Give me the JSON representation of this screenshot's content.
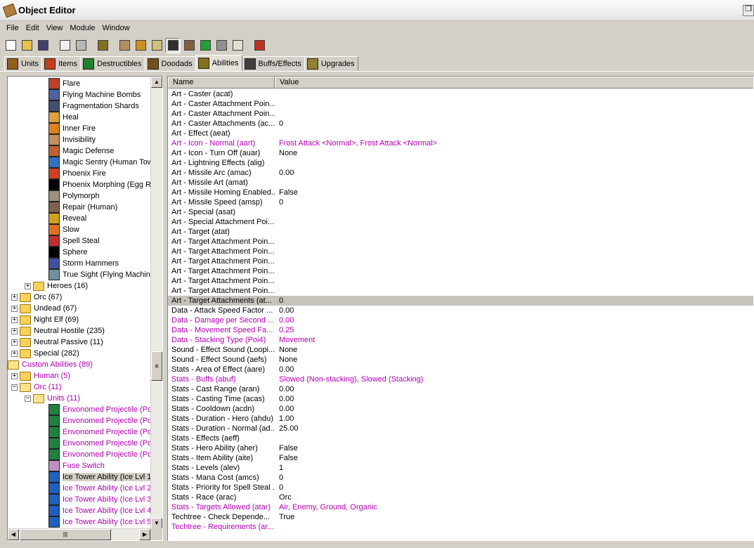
{
  "window": {
    "title": "Object Editor",
    "restore_glyph": "❐"
  },
  "menu": [
    "File",
    "Edit",
    "View",
    "Module",
    "Window"
  ],
  "toolbar": {
    "buttons": [
      {
        "icon": "new-icon",
        "color": "#ffffff"
      },
      {
        "icon": "open-icon",
        "color": "#e8c050"
      },
      {
        "icon": "save-icon",
        "color": "#404070"
      },
      {
        "sep": true
      },
      {
        "icon": "copy-icon",
        "color": "#f0f0f0"
      },
      {
        "icon": "paste-icon",
        "color": "#b8b8b8"
      },
      {
        "sep": true
      },
      {
        "icon": "abilities-icon",
        "color": "#807020"
      },
      {
        "sep": true
      },
      {
        "icon": "terrain-icon",
        "color": "#b09060"
      },
      {
        "icon": "doodad-icon",
        "color": "#d09020"
      },
      {
        "icon": "sound-icon",
        "color": "#d0c080"
      },
      {
        "icon": "object-icon",
        "color": "#303030",
        "pressed": true
      },
      {
        "icon": "camera-icon",
        "color": "#806040"
      },
      {
        "icon": "region-icon",
        "color": "#20a030"
      },
      {
        "icon": "unit-icon",
        "color": "#909090"
      },
      {
        "icon": "import-icon",
        "color": "#e0e0d0"
      },
      {
        "sep": true
      },
      {
        "icon": "test-map-icon",
        "color": "#c03020"
      }
    ]
  },
  "tabs": [
    {
      "label": "Units",
      "icon": "units-tab-icon",
      "color": "#906020",
      "active": false
    },
    {
      "label": "Items",
      "icon": "items-tab-icon",
      "color": "#c04020",
      "active": false
    },
    {
      "label": "Destructibles",
      "icon": "destructibles-tab-icon",
      "color": "#208030",
      "active": false
    },
    {
      "label": "Doodads",
      "icon": "doodads-tab-icon",
      "color": "#705020",
      "active": false
    },
    {
      "label": "Abilities",
      "icon": "abilities-tab-icon",
      "color": "#807020",
      "active": true
    },
    {
      "label": "Buffs/Effects",
      "icon": "buffs-tab-icon",
      "color": "#404040",
      "active": false
    },
    {
      "label": "Upgrades",
      "icon": "upgrades-tab-icon",
      "color": "#908030",
      "active": false
    }
  ],
  "tree": [
    {
      "label": "Flare",
      "type": "ability",
      "indent": 58,
      "color": "#c04030"
    },
    {
      "label": "Flying Machine Bombs",
      "type": "ability",
      "indent": 58,
      "color": "#5060a0"
    },
    {
      "label": "Fragmentation Shards",
      "type": "ability",
      "indent": 58,
      "color": "#405070"
    },
    {
      "label": "Heal",
      "type": "ability",
      "indent": 58,
      "color": "#e0a040"
    },
    {
      "label": "Inner Fire",
      "type": "ability",
      "indent": 58,
      "color": "#e08020"
    },
    {
      "label": "Invisibility",
      "type": "ability",
      "indent": 58,
      "color": "#c09060"
    },
    {
      "label": "Magic Defense",
      "type": "ability",
      "indent": 58,
      "color": "#c06030"
    },
    {
      "label": "Magic Sentry (Human Tow",
      "type": "ability",
      "indent": 58,
      "color": "#3070c0"
    },
    {
      "label": "Phoenix Fire",
      "type": "ability",
      "indent": 58,
      "color": "#d04020"
    },
    {
      "label": "Phoenix Morphing (Egg Re",
      "type": "ability",
      "indent": 58,
      "color": "#000000"
    },
    {
      "label": "Polymorph",
      "type": "ability",
      "indent": 58,
      "color": "#a09080"
    },
    {
      "label": "Repair (Human)",
      "type": "ability",
      "indent": 58,
      "color": "#806050"
    },
    {
      "label": "Reveal",
      "type": "ability",
      "indent": 58,
      "color": "#d0a020"
    },
    {
      "label": "Slow",
      "type": "ability",
      "indent": 58,
      "color": "#e07020"
    },
    {
      "label": "Spell Steal",
      "type": "ability",
      "indent": 58,
      "color": "#c03030"
    },
    {
      "label": "Sphere",
      "type": "ability",
      "indent": 58,
      "color": "#000000"
    },
    {
      "label": "Storm Hammers",
      "type": "ability",
      "indent": 58,
      "color": "#4050a0"
    },
    {
      "label": "True Sight (Flying Machine",
      "type": "ability",
      "indent": 58,
      "color": "#7090a0"
    },
    {
      "label": "Heroes (16)",
      "type": "folder",
      "indent": 24,
      "exp": "+"
    },
    {
      "label": "Orc (67)",
      "type": "folder",
      "indent": 5,
      "exp": "+"
    },
    {
      "label": "Undead (67)",
      "type": "folder",
      "indent": 5,
      "exp": "+"
    },
    {
      "label": "Night Elf (69)",
      "type": "folder",
      "indent": 5,
      "exp": "+"
    },
    {
      "label": "Neutral Hostile (235)",
      "type": "folder",
      "indent": 5,
      "exp": "+"
    },
    {
      "label": "Neutral Passive (11)",
      "type": "folder",
      "indent": 5,
      "exp": "+"
    },
    {
      "label": "Special (282)",
      "type": "folder",
      "indent": 5,
      "exp": "+"
    },
    {
      "label": "Custom Abilities (89)",
      "type": "folder-open",
      "indent": 0,
      "purple": true
    },
    {
      "label": "Human (5)",
      "type": "folder",
      "indent": 5,
      "exp": "+",
      "purple": true
    },
    {
      "label": "Orc (11)",
      "type": "folder-open",
      "indent": 5,
      "exp": "−",
      "purple": true
    },
    {
      "label": "Units (11)",
      "type": "folder-open",
      "indent": 24,
      "exp": "−",
      "purple": true
    },
    {
      "label": "Envonomed Projectile (Poi",
      "type": "ability",
      "indent": 58,
      "color": "#208040",
      "purple": true
    },
    {
      "label": "Envonomed Projectile (Poi",
      "type": "ability",
      "indent": 58,
      "color": "#208040",
      "purple": true
    },
    {
      "label": "Envonomed Projectile (Poi",
      "type": "ability",
      "indent": 58,
      "color": "#208040",
      "purple": true
    },
    {
      "label": "Envonomed Projectile (Poi",
      "type": "ability",
      "indent": 58,
      "color": "#208040",
      "purple": true
    },
    {
      "label": "Envonomed Projectile (Poi",
      "type": "ability",
      "indent": 58,
      "color": "#208040",
      "purple": true
    },
    {
      "label": "Fuse Switch",
      "type": "ability",
      "indent": 58,
      "color": "#c090c0",
      "purple": true
    },
    {
      "label": "Ice Tower Ability (Ice Lvl 1",
      "type": "ability",
      "indent": 58,
      "color": "#2060c0",
      "selected": true
    },
    {
      "label": "Ice Tower Ability (Ice Lvl 2",
      "type": "ability",
      "indent": 58,
      "color": "#2060c0",
      "purple": true
    },
    {
      "label": "Ice Tower Ability (Ice Lvl 3",
      "type": "ability",
      "indent": 58,
      "color": "#2060c0",
      "purple": true
    },
    {
      "label": "Ice Tower Ability (Ice Lvl 4",
      "type": "ability",
      "indent": 58,
      "color": "#2060c0",
      "purple": true
    },
    {
      "label": "Ice Tower Ability (Ice Lvl 5",
      "type": "ability",
      "indent": 58,
      "color": "#2060c0",
      "purple": true
    }
  ],
  "scroll": {
    "grip": "≡",
    "hgrip": "|||",
    "up": "▲",
    "down": "▼",
    "left": "◀",
    "right": "▶"
  },
  "grid": {
    "columns": [
      "Name",
      "Value"
    ],
    "rows": [
      {
        "name": "Art - Caster (acat)",
        "value": ""
      },
      {
        "name": "Art - Caster Attachment Poin...",
        "value": ""
      },
      {
        "name": "Art - Caster Attachment Poin...",
        "value": ""
      },
      {
        "name": "Art - Caster Attachments (ac...",
        "value": "0"
      },
      {
        "name": "Art - Effect (aeat)",
        "value": ""
      },
      {
        "name": "Art - Icon - Normal (aart)",
        "value": "Frost Attack <Normal>, Frost Attack <Normal>",
        "purple": true
      },
      {
        "name": "Art - Icon - Turn Off (auar)",
        "value": "None"
      },
      {
        "name": "Art - Lightning Effects (alig)",
        "value": ""
      },
      {
        "name": "Art - Missile Arc (amac)",
        "value": "0.00"
      },
      {
        "name": "Art - Missile Art (amat)",
        "value": ""
      },
      {
        "name": "Art - Missile Homing Enabled...",
        "value": "False"
      },
      {
        "name": "Art - Missile Speed (amsp)",
        "value": "0"
      },
      {
        "name": "Art - Special (asat)",
        "value": ""
      },
      {
        "name": "Art - Special Attachment Poi...",
        "value": ""
      },
      {
        "name": "Art - Target (atat)",
        "value": ""
      },
      {
        "name": "Art - Target Attachment Poin...",
        "value": ""
      },
      {
        "name": "Art - Target Attachment Poin...",
        "value": ""
      },
      {
        "name": "Art - Target Attachment Poin...",
        "value": ""
      },
      {
        "name": "Art - Target Attachment Poin...",
        "value": ""
      },
      {
        "name": "Art - Target Attachment Poin...",
        "value": ""
      },
      {
        "name": "Art - Target Attachment Poin...",
        "value": ""
      },
      {
        "name": "Art - Target Attachments (at...",
        "value": "0",
        "selected": true
      },
      {
        "name": "Data - Attack Speed Factor ...",
        "value": "0.00"
      },
      {
        "name": "Data - Damage per Second ...",
        "value": "0.00",
        "purple": true
      },
      {
        "name": "Data - Movement Speed Fa...",
        "value": "0.25",
        "purple": true
      },
      {
        "name": "Data - Stacking Type (Poi4)",
        "value": "Movement",
        "purple": true
      },
      {
        "name": "Sound - Effect Sound (Loopi...",
        "value": "None"
      },
      {
        "name": "Sound - Effect Sound (aefs)",
        "value": "None"
      },
      {
        "name": "Stats - Area of Effect (aare)",
        "value": "0.00"
      },
      {
        "name": "Stats - Buffs (abuf)",
        "value": "Slowed (Non-stacking), Slowed (Stacking)",
        "purple": true
      },
      {
        "name": "Stats - Cast Range (aran)",
        "value": "0.00"
      },
      {
        "name": "Stats - Casting Time (acas)",
        "value": "0.00"
      },
      {
        "name": "Stats - Cooldown (acdn)",
        "value": "0.00"
      },
      {
        "name": "Stats - Duration - Hero (ahdu)",
        "value": "1.00"
      },
      {
        "name": "Stats - Duration - Normal (ad...",
        "value": "25.00"
      },
      {
        "name": "Stats - Effects (aeff)",
        "value": ""
      },
      {
        "name": "Stats - Hero Ability (aher)",
        "value": "False"
      },
      {
        "name": "Stats - Item Ability (aite)",
        "value": "False"
      },
      {
        "name": "Stats - Levels (alev)",
        "value": "1"
      },
      {
        "name": "Stats - Mana Cost (amcs)",
        "value": "0"
      },
      {
        "name": "Stats - Priority for Spell Steal ...",
        "value": "0"
      },
      {
        "name": "Stats - Race (arac)",
        "value": "Orc"
      },
      {
        "name": "Stats - Targets Allowed (atar)",
        "value": "Air, Enemy, Ground, Organic",
        "purple": true
      },
      {
        "name": "Techtree - Check Depende...",
        "value": "True"
      },
      {
        "name": "Techtree - Requirements (ar...",
        "value": "",
        "purple": true
      }
    ]
  }
}
